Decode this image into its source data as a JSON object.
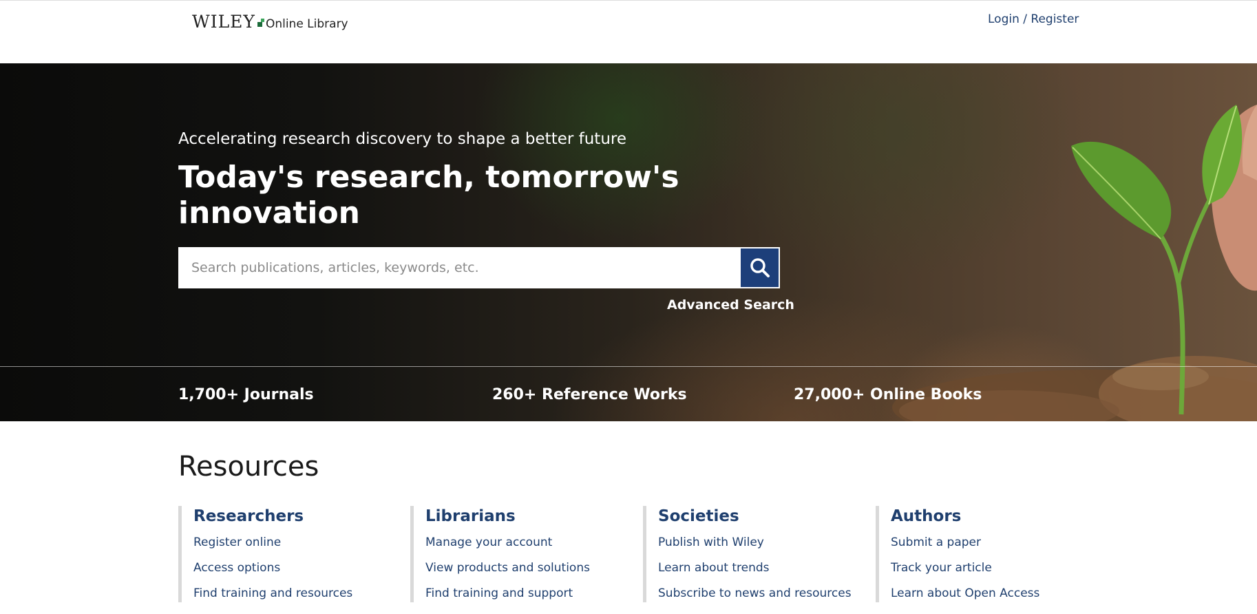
{
  "header": {
    "logo_brand": "WILEY",
    "logo_product": "Online Library",
    "login_label": "Login / Register"
  },
  "hero": {
    "tagline": "Accelerating research discovery to shape a better future",
    "title": "Today's research, tomorrow's innovation",
    "search": {
      "placeholder": "Search publications, articles, keywords, etc.",
      "value": "",
      "button_icon": "search-icon"
    },
    "advanced_search_label": "Advanced Search",
    "stats": [
      "1,700+ Journals",
      "260+ Reference Works",
      "27,000+ Online Books"
    ]
  },
  "resources": {
    "title": "Resources",
    "columns": [
      {
        "heading": "Researchers",
        "links": [
          "Register online",
          "Access options",
          "Find training and resources"
        ]
      },
      {
        "heading": "Librarians",
        "links": [
          "Manage your account",
          "View products and solutions",
          "Find training and support"
        ]
      },
      {
        "heading": "Societies",
        "links": [
          "Publish with Wiley",
          "Learn about trends",
          "Subscribe to news and resources"
        ]
      },
      {
        "heading": "Authors",
        "links": [
          "Submit a paper",
          "Track your article",
          "Learn about Open Access"
        ]
      }
    ]
  },
  "colors": {
    "brand_navy": "#1f3f6e",
    "search_button": "#1d3f7a",
    "logo_green": "#1b6b3a"
  }
}
